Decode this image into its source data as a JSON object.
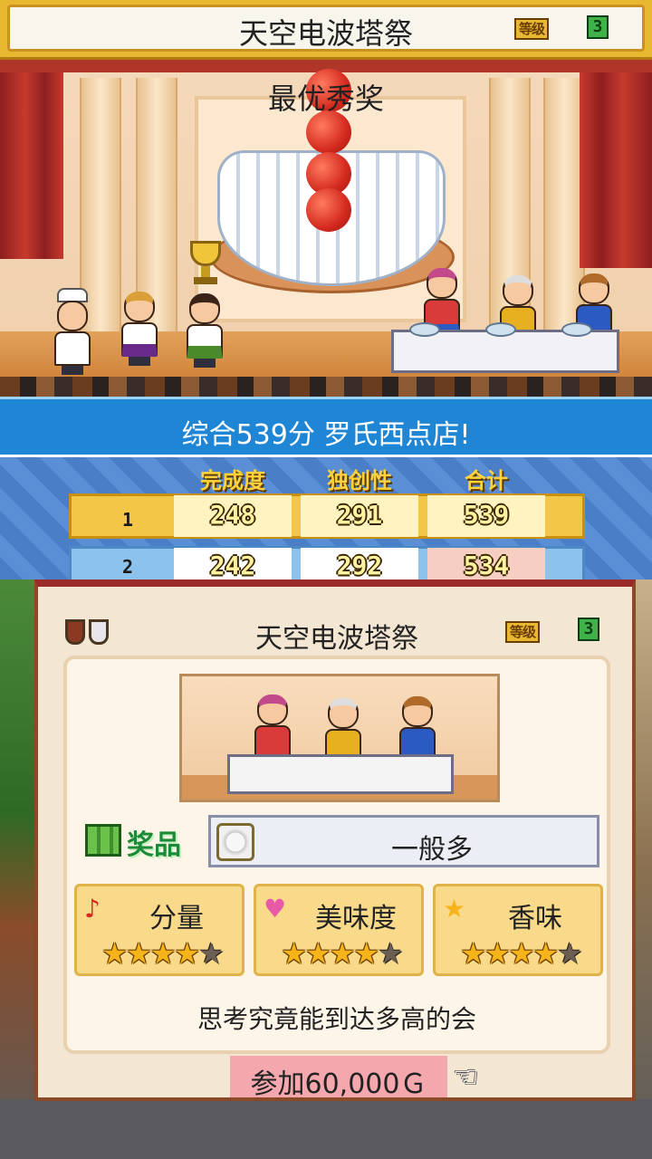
{
  "header": {
    "title": "天空电波塔祭",
    "grade_label": "等级",
    "grade_value": "3"
  },
  "scene": {
    "award_title": "最优秀奖"
  },
  "result": {
    "message": "综合539分 罗氏西点店!",
    "columns": [
      "完成度",
      "独创性",
      "合计"
    ],
    "rows": [
      {
        "rank": "1",
        "completion": "248",
        "originality": "291",
        "total": "539"
      },
      {
        "rank": "2",
        "completion": "242",
        "originality": "292",
        "total": "534"
      }
    ]
  },
  "contest": {
    "title": "天空电波塔祭",
    "grade_label": "等级",
    "grade_value": "3",
    "prize_label": "奖品",
    "prize_value": "一般多",
    "ratings": [
      {
        "label": "分量",
        "icon": "music-note-icon",
        "stars": 4,
        "max": 5
      },
      {
        "label": "美味度",
        "icon": "heart-icon",
        "stars": 4,
        "max": 5
      },
      {
        "label": "香味",
        "icon": "star-icon",
        "stars": 4,
        "max": 5
      }
    ],
    "description": "思考究竟能到达多高的会",
    "entry_fee": "参加60,000Ｇ"
  },
  "colors": {
    "score_band": "#1f86d6",
    "prize_green": "#1d8a3a",
    "rating_bg": "#f9d98a",
    "fee_bg": "#f4a7ad"
  }
}
